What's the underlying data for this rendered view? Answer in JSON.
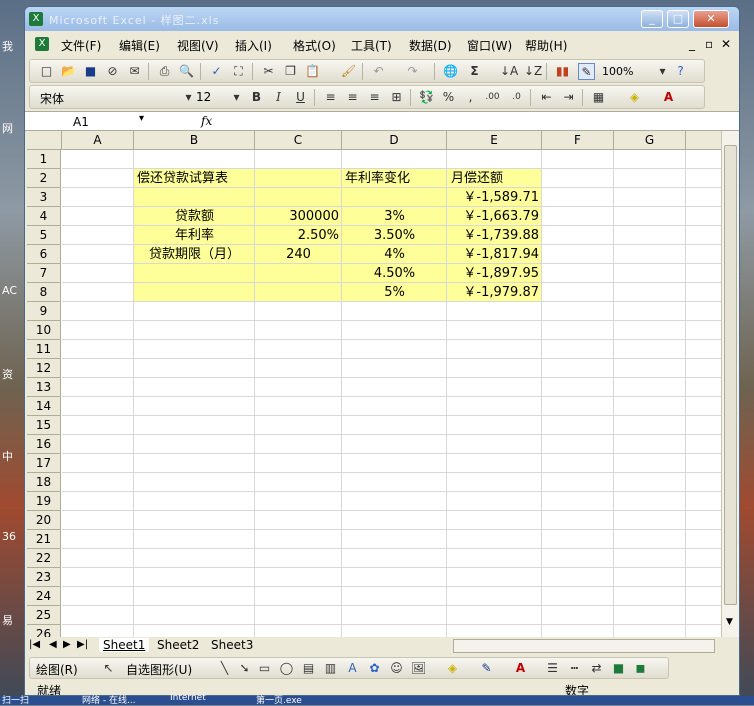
{
  "desktop": {
    "side_labels": [
      "我",
      "网",
      "AC",
      "资",
      "中",
      "36",
      "易"
    ],
    "taskbar_items": [
      "扫一扫",
      "网络 - 在线...",
      "Internet",
      "第一页.exe"
    ]
  },
  "window": {
    "title": "Microsoft Excel - 样图二.xls"
  },
  "menu": {
    "items": [
      "文件(F)",
      "编辑(E)",
      "视图(V)",
      "插入(I)",
      "格式(O)",
      "工具(T)",
      "数据(D)",
      "窗口(W)",
      "帮助(H)"
    ]
  },
  "toolbar": {
    "zoom": "100%",
    "font": "宋体",
    "size": "12"
  },
  "formula_bar": {
    "name_box": "A1",
    "fx": "fx",
    "content": ""
  },
  "columns": [
    "A",
    "B",
    "C",
    "D",
    "E",
    "F",
    "G"
  ],
  "rows": [
    "1",
    "2",
    "3",
    "4",
    "5",
    "6",
    "7",
    "8",
    "9",
    "10",
    "11",
    "12",
    "13",
    "14",
    "15",
    "16",
    "17",
    "18",
    "19",
    "20",
    "21",
    "22",
    "23",
    "24",
    "25",
    "26"
  ],
  "cells": {
    "B2": "偿还贷款试算表",
    "D2": "年利率变化",
    "E2": "月偿还额",
    "E3": "￥-1,589.71",
    "B4": "贷款额",
    "C4": "300000",
    "D4": "3%",
    "E4": "￥-1,663.79",
    "B5": "年利率",
    "C5": "2.50%",
    "D5": "3.50%",
    "E5": "￥-1,739.88",
    "B6": "贷款期限（月）",
    "C6": "240",
    "D6": "4%",
    "E6": "￥-1,817.94",
    "D7": "4.50%",
    "E7": "￥-1,897.95",
    "D8": "5%",
    "E8": "￥-1,979.87"
  },
  "sheets": [
    "Sheet1",
    "Sheet2",
    "Sheet3"
  ],
  "drawing_toolbar": {
    "draw_label": "绘图(R)",
    "autoshape_label": "自选图形(U)"
  },
  "status": {
    "left": "就绪",
    "right": "数字"
  },
  "colors": {
    "highlight": "#ffff99",
    "titlebar": "#9bbbe6"
  }
}
